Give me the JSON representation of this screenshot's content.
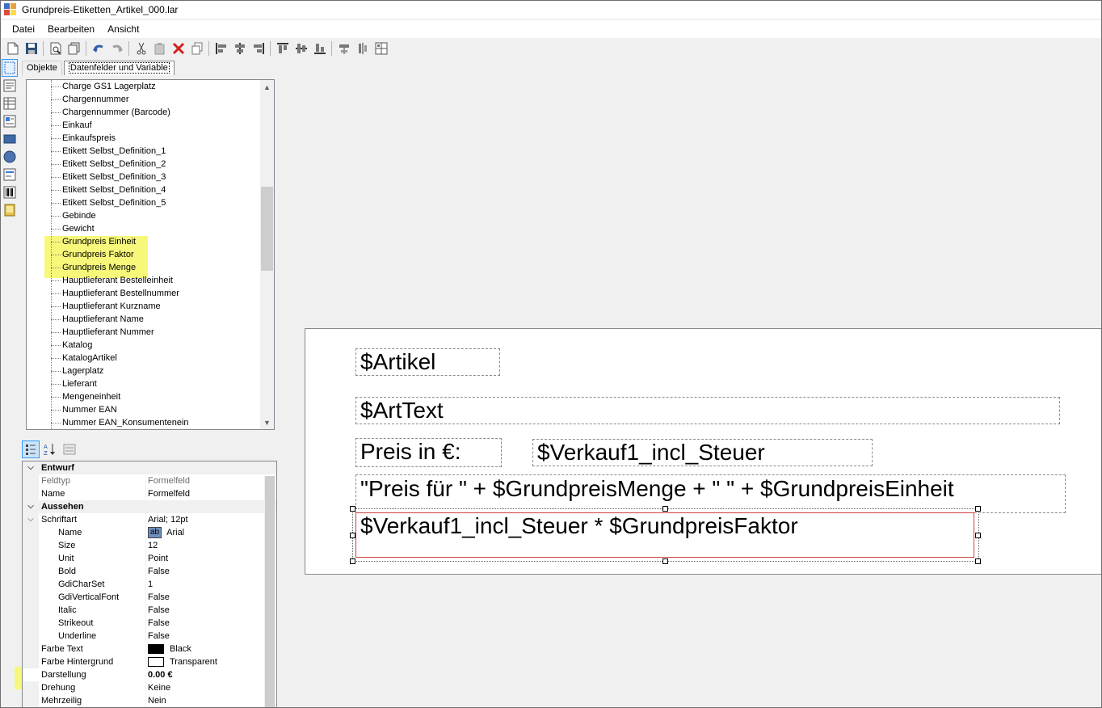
{
  "window": {
    "title": "Grundpreis-Etiketten_Artikel_000.lar"
  },
  "menu": [
    "Datei",
    "Bearbeiten",
    "Ansicht"
  ],
  "toolbar": {
    "icons": [
      "new-icon",
      "save-icon",
      "preview-icon",
      "copy-pages-icon",
      "undo-icon",
      "redo-icon",
      "cut-icon",
      "paste-icon",
      "delete-icon",
      "copy-icon",
      "align-left-icon",
      "align-center-icon",
      "align-right-icon",
      "align-top-icon",
      "align-middle-icon",
      "align-bottom-icon",
      "distribute-horizontal-icon",
      "distribute-vertical-icon",
      "grid-icon"
    ]
  },
  "toolbox": [
    "select-tool-icon",
    "text-tool-icon",
    "table-tool-icon",
    "picture-tool-icon",
    "rectangle-tool-icon",
    "ellipse-tool-icon",
    "formula-tool-icon",
    "barcode-tool-icon",
    "image-tool-icon"
  ],
  "tabs": [
    {
      "label": "Objekte",
      "active": false
    },
    {
      "label": "Datenfelder und Variable",
      "active": true
    }
  ],
  "tree": {
    "items": [
      "Charge GS1 Lagerplatz",
      "Chargennummer",
      "Chargennummer (Barcode)",
      "Einkauf",
      "Einkaufspreis",
      "Etikett Selbst_Definition_1",
      "Etikett Selbst_Definition_2",
      "Etikett Selbst_Definition_3",
      "Etikett Selbst_Definition_4",
      "Etikett Selbst_Definition_5",
      "Gebinde",
      "Gewicht",
      "Grundpreis Einheit",
      "Grundpreis Faktor",
      "Grundpreis Menge",
      "Hauptlieferant Bestelleinheit",
      "Hauptlieferant Bestellnummer",
      "Hauptlieferant Kurzname",
      "Hauptlieferant Name",
      "Hauptlieferant Nummer",
      "Katalog",
      "KatalogArtikel",
      "Lagerplatz",
      "Lieferant",
      "Mengeneinheit",
      "Nummer EAN",
      "Nummer EAN_Konsumentenein"
    ],
    "highlighted": [
      "Grundpreis Einheit",
      "Grundpreis Faktor",
      "Grundpreis Menge"
    ],
    "scroll_position": 0.39,
    "visible_fraction": 0.26,
    "highlight_color": "#f7f87a"
  },
  "property_toolbar": [
    "categorized-icon",
    "alphabetical-icon",
    "property-pages-icon"
  ],
  "properties": {
    "cat_entwurf": "Entwurf",
    "feldtyp_name": "Feldtyp",
    "feldtyp_value": "Formelfeld",
    "name_name": "Name",
    "name_value": "Formelfeld",
    "cat_aussehen": "Aussehen",
    "schriftart_name": "Schriftart",
    "schriftart_value": "Arial; 12pt",
    "font_name_name": "Name",
    "font_name_glyph": "ab",
    "font_name_value": "Arial",
    "size_name": "Size",
    "size_value": "12",
    "unit_name": "Unit",
    "unit_value": "Point",
    "bold_name": "Bold",
    "bold_value": "False",
    "gdicharset_name": "GdiCharSet",
    "gdicharset_value": "1",
    "gdivertical_name": "GdiVerticalFont",
    "gdivertical_value": "False",
    "italic_name": "Italic",
    "italic_value": "False",
    "strikeout_name": "Strikeout",
    "strikeout_value": "False",
    "underline_name": "Underline",
    "underline_value": "False",
    "farbe_text_name": "Farbe Text",
    "farbe_text_value": "Black",
    "farbe_text_color": "#000000",
    "farbe_hg_name": "Farbe Hintergrund",
    "farbe_hg_value": "Transparent",
    "farbe_hg_color": "#ffffff",
    "darstellung_name": "Darstellung",
    "darstellung_value": "0.00 €",
    "drehung_name": "Drehung",
    "drehung_value": "Keine",
    "mehrzeilig_name": "Mehrzeilig",
    "mehrzeilig_value": "Nein"
  },
  "label": {
    "fields": {
      "artikel": "$Artikel",
      "arttext": "$ArtText",
      "preis": "Preis in €:",
      "verkauf": "$Verkauf1_incl_Steuer",
      "formel_preis": "\"Preis für \" + $GrundpreisMenge + \" \" + $GrundpreisEinheit",
      "formel_faktor": "$Verkauf1_incl_Steuer * $GrundpreisFaktor"
    }
  }
}
